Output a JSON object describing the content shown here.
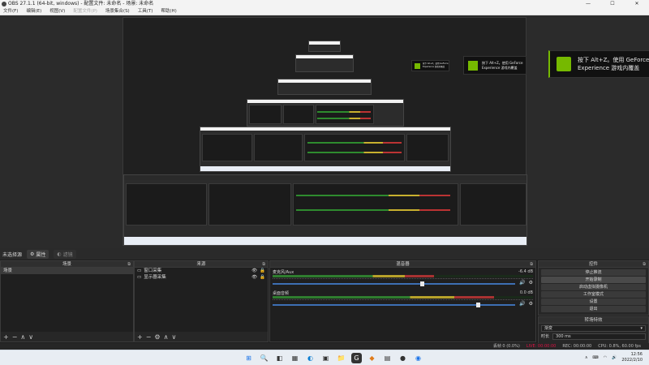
{
  "window": {
    "title": "OBS 27.1.1 (64-bit, windows) - 配置文件: 未命名 - 场景: 未命名",
    "controls": [
      "—",
      "☐",
      "✕"
    ]
  },
  "menu": [
    {
      "label": "文件(F)",
      "dim": false
    },
    {
      "label": "编辑(E)",
      "dim": false
    },
    {
      "label": "视图(V)",
      "dim": false
    },
    {
      "label": "配置文件(P)",
      "dim": true
    },
    {
      "label": "场景集合(S)",
      "dim": false
    },
    {
      "label": "工具(T)",
      "dim": false
    },
    {
      "label": "帮助(H)",
      "dim": false
    }
  ],
  "nvidia": {
    "logo": "NV",
    "line1": "按下 Alt+Z。使用 GeForce",
    "line2": "Experience 游戏内覆盖"
  },
  "scene_bar": {
    "label": "未选择源",
    "props": "属性",
    "filters": "滤镜"
  },
  "scenes": {
    "title": "场景",
    "items": [
      "场景"
    ],
    "footer": [
      "+",
      "−",
      "∧",
      "∨"
    ]
  },
  "sources": {
    "title": "来源",
    "items": [
      {
        "name": "窗口采集",
        "icon": "▭"
      },
      {
        "name": "显示器采集",
        "icon": "▭"
      }
    ],
    "footer": [
      "+",
      "−",
      "⚙",
      "∧",
      "∨"
    ]
  },
  "mixer": {
    "title": "混音器",
    "channels": [
      {
        "name": "麦克风/Aux",
        "db": "-6.4 dB",
        "level": 0.62
      },
      {
        "name": "桌面音频",
        "db": "0.0 dB",
        "level": 0.85
      }
    ]
  },
  "controls": {
    "title": "控件",
    "buttons": [
      {
        "label": "停止推流",
        "hi": false
      },
      {
        "label": "开始录制",
        "hi": true
      },
      {
        "label": "启动虚拟摄像机",
        "hi": false
      },
      {
        "label": "工作室模式",
        "hi": false
      },
      {
        "label": "设置",
        "hi": false
      },
      {
        "label": "退出",
        "hi": false
      }
    ]
  },
  "transitions": {
    "title": "转场特效",
    "selected": "渐变",
    "duration_label": "时长",
    "duration": "300 ms"
  },
  "status": {
    "dropped": "丢帧 0 (0.0%)",
    "live": "LIVE: 00:00:00",
    "rec": "REC: 00:00:00",
    "cpu": "CPU: 0.8%, 60.00 fps"
  },
  "taskbar": {
    "icons": [
      "⊞",
      "🔍",
      "◧",
      "▦",
      "◐",
      "▣",
      "📁",
      "G",
      "◆",
      "▤",
      "●",
      "◉"
    ],
    "time": "12:56",
    "date": "2022/2/10"
  }
}
